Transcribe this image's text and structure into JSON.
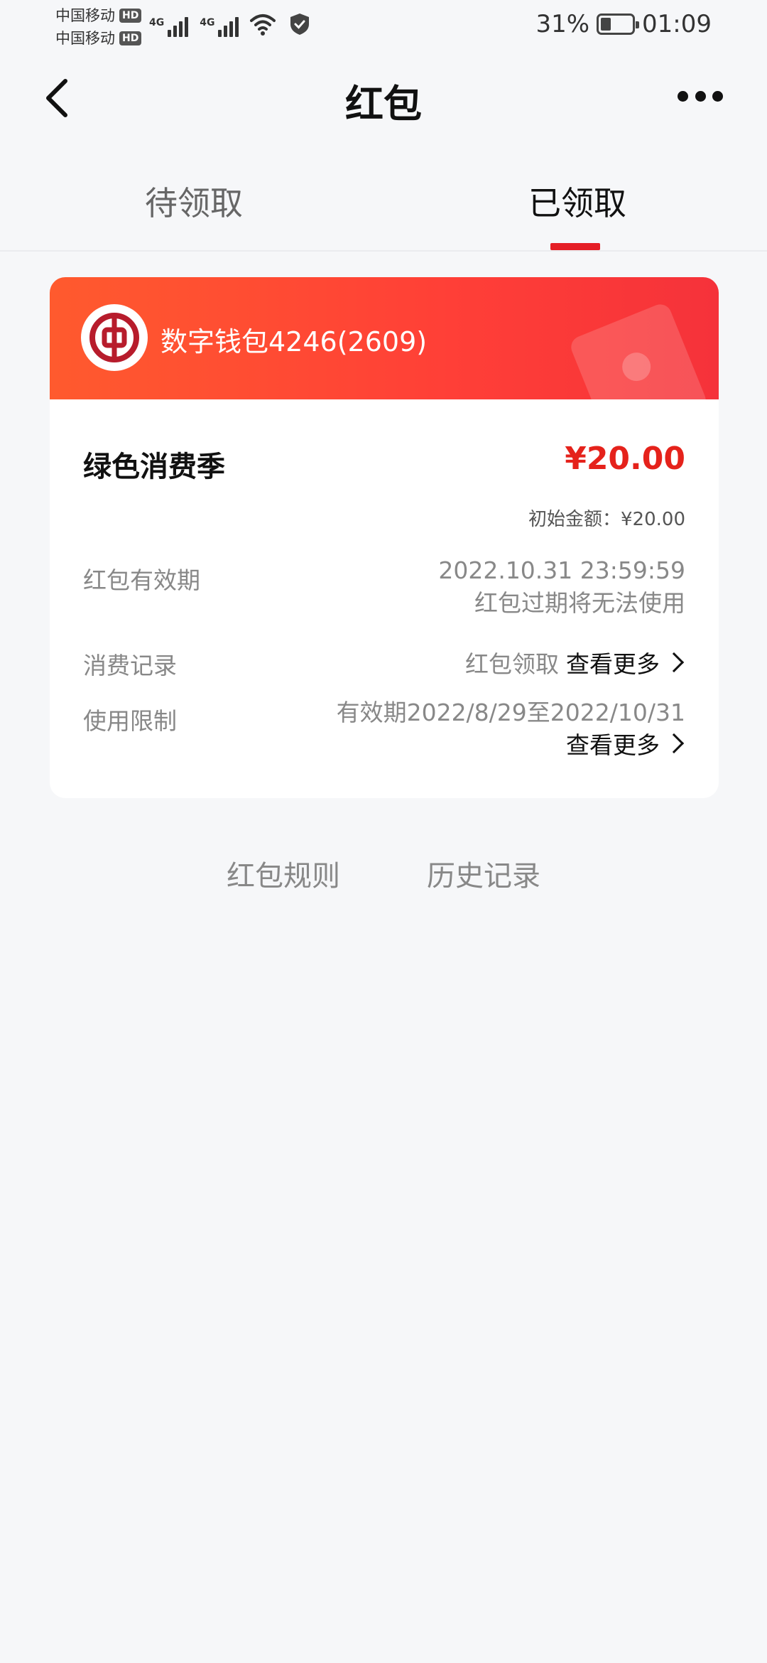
{
  "status": {
    "carrier1": "中国移动",
    "carrier2": "中国移动",
    "hd": "HD",
    "net1": "4G",
    "net2": "4G",
    "battery": "31%",
    "time": "01:09"
  },
  "nav": {
    "title": "红包",
    "back_icon": "chevron-left-icon",
    "more_icon": "more-dots-icon"
  },
  "tabs": [
    {
      "label": "待领取",
      "active": false
    },
    {
      "label": "已领取",
      "active": true
    }
  ],
  "card": {
    "wallet_name": "数字钱包4246(2609)",
    "packet_name": "绿色消费季",
    "amount": "¥20.00",
    "initial_amount": "初始金额：¥20.00",
    "rows": {
      "validity_label": "红包有效期",
      "validity_value": "2022.10.31 23:59:59",
      "validity_note": "红包过期将无法使用",
      "records_label": "消费记录",
      "records_value": "红包领取",
      "records_link": "查看更多",
      "limit_label": "使用限制",
      "limit_value": "有效期2022/8/29至2022/10/31",
      "limit_link": "查看更多"
    },
    "accent_color": "#e5221b",
    "header_color": "#ff4b33"
  },
  "footer": {
    "rules": "红包规则",
    "history": "历史记录"
  }
}
